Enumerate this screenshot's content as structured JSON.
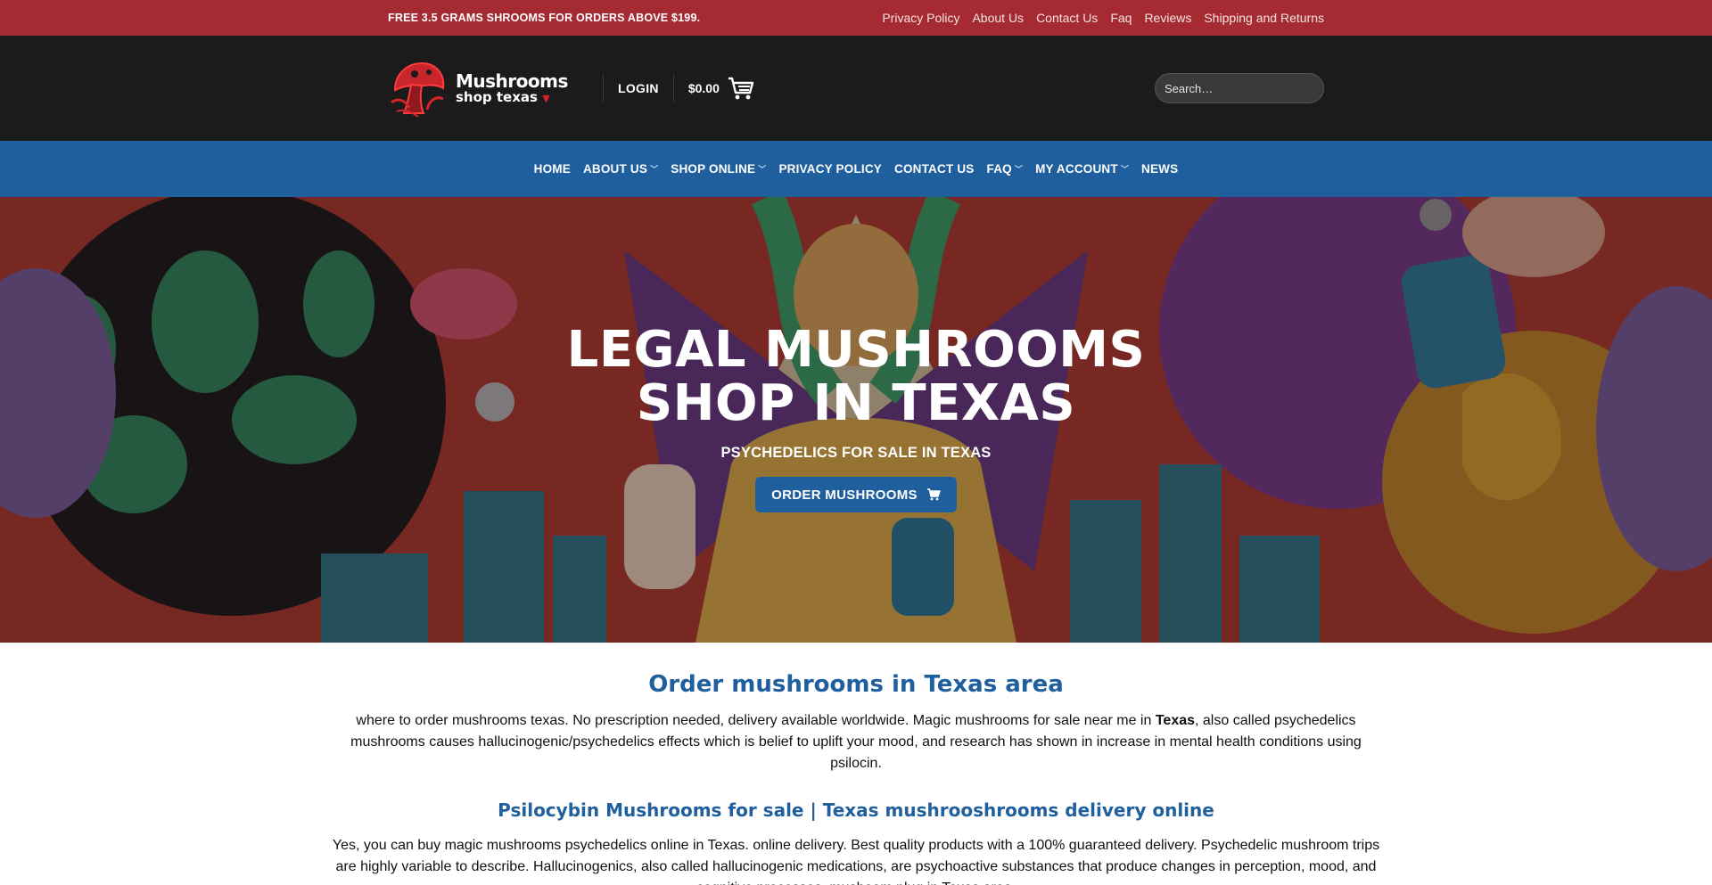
{
  "topbar": {
    "promo": "FREE 3.5 GRAMS SHROOMS FOR ORDERS ABOVE $199.",
    "links": [
      "Privacy Policy",
      "About Us",
      "Contact Us",
      "Faq",
      "Reviews",
      "Shipping and Returns"
    ]
  },
  "header": {
    "logo_line1": "Mushrooms",
    "logo_line2": "shop texas",
    "login": "LOGIN",
    "cart_total": "$0.00",
    "search_placeholder": "Search…"
  },
  "nav": {
    "items": [
      "HOME",
      "ABOUT US",
      "SHOP ONLINE",
      "PRIVACY POLICY",
      "CONTACT US",
      "FAQ",
      "MY ACCOUNT",
      "NEWS"
    ]
  },
  "hero": {
    "title_line1": "LEGAL MUSHROOMS",
    "title_line2": "SHOP IN TEXAS",
    "subtitle": "PSYCHEDELICS FOR SALE IN TEXAS",
    "button": "ORDER MUSHROOMS"
  },
  "content": {
    "heading": "Order mushrooms in Texas area",
    "para1_a": "where to order mushrooms texas.  No prescription needed, delivery available worldwide. Magic mushrooms for sale near me in ",
    "para1_bold": "Texas",
    "para1_b": ", also called psychedelics mushrooms causes hallucinogenic/psychedelics effects which is belief to uplift your mood, and research has shown in increase in mental health conditions using psilocin.",
    "subheading": "Psilocybin Mushrooms for sale | Texas mushrooshrooms delivery online",
    "para2": "Yes, you can buy magic mushrooms psychedelics online in Texas. online delivery. Best quality products with a 100% guaranteed delivery. Psychedelic mushroom trips are highly variable to describe. Hallucinogenics, also called hallucinogenic medications, are psychoactive substances that produce changes in perception, mood, and cognitive processes. mushoom plug in Texas area."
  },
  "colors": {
    "topbar": "#a52a31",
    "header": "#1b1b1b",
    "nav": "#1f5f9e",
    "heading": "#1f5f9e"
  }
}
